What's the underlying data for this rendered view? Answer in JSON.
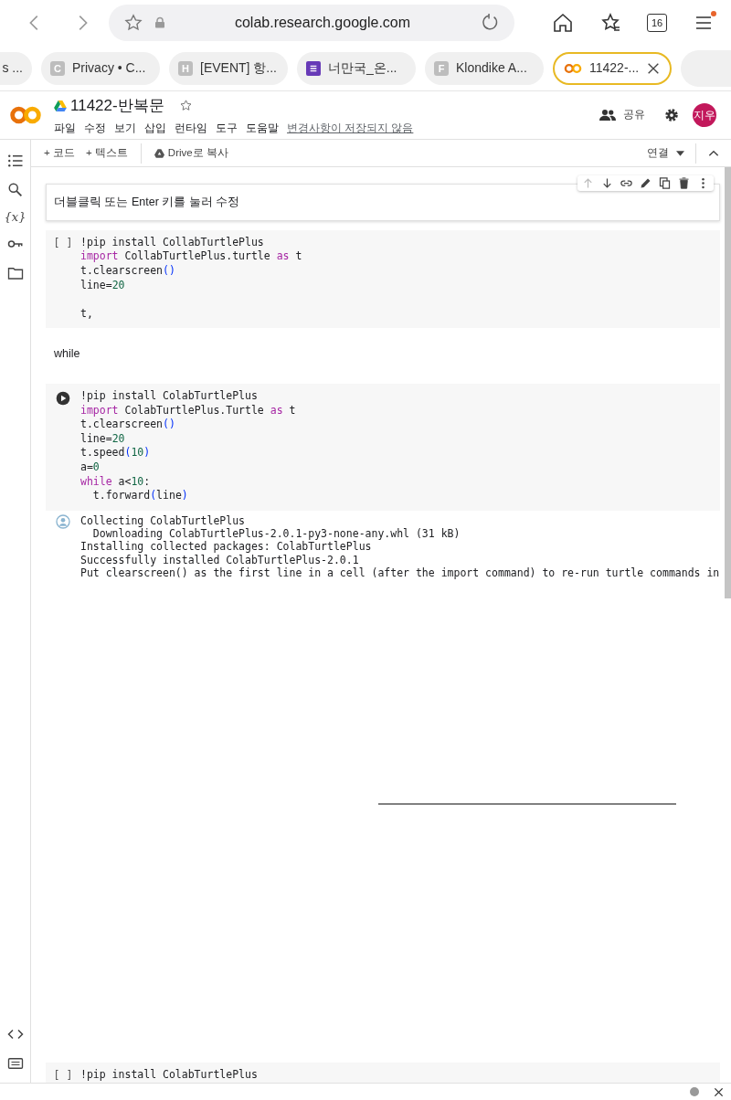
{
  "browser": {
    "url": "colab.research.google.com",
    "tab_count": "16"
  },
  "tabs": [
    {
      "label": "s ...",
      "kind": "plain",
      "selected": false
    },
    {
      "label": "Privacy • C...",
      "kind": "letter",
      "letter": "C",
      "selected": false
    },
    {
      "label": "[EVENT] 항...",
      "kind": "letter",
      "letter": "H",
      "selected": false
    },
    {
      "label": "너만국_온...",
      "kind": "form",
      "selected": false
    },
    {
      "label": "Klondike A...",
      "kind": "letter",
      "letter": "F",
      "selected": false
    },
    {
      "label": "11422-...",
      "kind": "colab",
      "selected": true
    }
  ],
  "header": {
    "title": "11422-반복문",
    "menu": [
      "파일",
      "수정",
      "보기",
      "삽입",
      "런타임",
      "도구",
      "도움말"
    ],
    "save_status": "변경사항이 저장되지 않음",
    "share": "공유",
    "avatar": "지우"
  },
  "toolbar": {
    "add_code": "+ 코드",
    "add_text": "+ 텍스트",
    "copy_to_drive": "Drive로 복사",
    "connect": "연결"
  },
  "sidebar": {
    "variables": "{x}"
  },
  "cells": [
    {
      "kind": "text",
      "text": "더블클릭 또는 Enter 키를 눌러 수정",
      "selected": true
    },
    {
      "kind": "code",
      "run_button": false,
      "prompt": "[ ]",
      "lines": [
        {
          "tokens": [
            {
              "t": "!pip install CollabTurtlePlus",
              "kind": "plain"
            }
          ]
        },
        {
          "tokens": [
            {
              "t": "import",
              "kind": "kw"
            },
            {
              "t": " CollabTurtlePlus.turtle ",
              "kind": "plain"
            },
            {
              "t": "as",
              "kind": "kw"
            },
            {
              "t": " t",
              "kind": "plain"
            }
          ]
        },
        {
          "tokens": [
            {
              "t": "t.clearscreen",
              "kind": "plain"
            },
            {
              "t": "()",
              "kind": "paren"
            }
          ]
        },
        {
          "tokens": [
            {
              "t": "line=",
              "kind": "plain"
            },
            {
              "t": "20",
              "kind": "num"
            }
          ]
        },
        {
          "kind": "blank"
        },
        {
          "tokens": [
            {
              "t": "t,",
              "kind": "plain"
            }
          ]
        }
      ]
    },
    {
      "kind": "text",
      "text": "while",
      "selected": false
    },
    {
      "kind": "code",
      "run_button": true,
      "lines": [
        {
          "tokens": [
            {
              "t": "!pip install ColabTurtlePlus",
              "kind": "plain"
            }
          ]
        },
        {
          "tokens": [
            {
              "t": "import",
              "kind": "kw"
            },
            {
              "t": " ColabTurtlePlus.Turtle ",
              "kind": "plain"
            },
            {
              "t": "as",
              "kind": "kw"
            },
            {
              "t": " t",
              "kind": "plain"
            }
          ]
        },
        {
          "tokens": [
            {
              "t": "t.clearscreen",
              "kind": "plain"
            },
            {
              "t": "()",
              "kind": "paren"
            }
          ]
        },
        {
          "tokens": [
            {
              "t": "line=",
              "kind": "plain"
            },
            {
              "t": "20",
              "kind": "num"
            }
          ]
        },
        {
          "tokens": [
            {
              "t": "t.speed",
              "kind": "plain"
            },
            {
              "t": "(",
              "kind": "paren"
            },
            {
              "t": "10",
              "kind": "num"
            },
            {
              "t": ")",
              "kind": "paren"
            }
          ]
        },
        {
          "tokens": [
            {
              "t": "a=",
              "kind": "plain"
            },
            {
              "t": "0",
              "kind": "num"
            }
          ]
        },
        {
          "tokens": [
            {
              "t": "while",
              "kind": "kw"
            },
            {
              "t": " a<",
              "kind": "plain"
            },
            {
              "t": "10",
              "kind": "num"
            },
            {
              "t": ":",
              "kind": "plain"
            }
          ]
        },
        {
          "tokens": [
            {
              "t": "  t.forward",
              "kind": "plain"
            },
            {
              "t": "(",
              "kind": "paren"
            },
            {
              "t": "line",
              "kind": "plain"
            },
            {
              "t": ")",
              "kind": "paren"
            }
          ]
        }
      ],
      "output": {
        "lines": [
          "Collecting ColabTurtlePlus",
          "  Downloading ColabTurtlePlus-2.0.1-py3-none-any.whl (31 kB)",
          "Installing collected packages: ColabTurtlePlus",
          "Successfully installed ColabTurtlePlus-2.0.1",
          "Put clearscreen() as the first line in a cell (after the import command) to re-run turtle commands in"
        ]
      }
    },
    {
      "kind": "code",
      "run_button": false,
      "prompt": "[ ]",
      "lines": [
        {
          "tokens": [
            {
              "t": "!pip install ColabTurtlePlus",
              "kind": "plain"
            }
          ]
        }
      ]
    }
  ]
}
